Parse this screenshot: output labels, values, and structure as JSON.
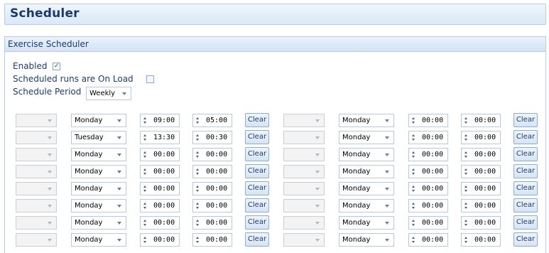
{
  "header": {
    "title": "Scheduler"
  },
  "panel": {
    "title": "Exercise Scheduler",
    "enabled_label": "Enabled",
    "enabled_checked": true,
    "onload_label": "Scheduled runs are On Load",
    "onload_checked": false,
    "period_label": "Schedule Period",
    "period_value": "Weekly"
  },
  "schedule": {
    "clear_label": "Clear",
    "rows": [
      {
        "left": {
          "day": "Monday",
          "start": "09:00",
          "duration": "05:00"
        },
        "right": {
          "day": "Monday",
          "start": "00:00",
          "duration": "00:00"
        }
      },
      {
        "left": {
          "day": "Tuesday",
          "start": "13:30",
          "duration": "00:30"
        },
        "right": {
          "day": "Monday",
          "start": "00:00",
          "duration": "00:00"
        }
      },
      {
        "left": {
          "day": "Monday",
          "start": "00:00",
          "duration": "00:00"
        },
        "right": {
          "day": "Monday",
          "start": "00:00",
          "duration": "00:00"
        }
      },
      {
        "left": {
          "day": "Monday",
          "start": "00:00",
          "duration": "00:00"
        },
        "right": {
          "day": "Monday",
          "start": "00:00",
          "duration": "00:00"
        }
      },
      {
        "left": {
          "day": "Monday",
          "start": "00:00",
          "duration": "00:00"
        },
        "right": {
          "day": "Monday",
          "start": "00:00",
          "duration": "00:00"
        }
      },
      {
        "left": {
          "day": "Monday",
          "start": "00:00",
          "duration": "00:00"
        },
        "right": {
          "day": "Monday",
          "start": "00:00",
          "duration": "00:00"
        }
      },
      {
        "left": {
          "day": "Monday",
          "start": "00:00",
          "duration": "00:00"
        },
        "right": {
          "day": "Monday",
          "start": "00:00",
          "duration": "00:00"
        }
      },
      {
        "left": {
          "day": "Monday",
          "start": "00:00",
          "duration": "00:00"
        },
        "right": {
          "day": "Monday",
          "start": "00:00",
          "duration": "00:00"
        }
      }
    ]
  }
}
